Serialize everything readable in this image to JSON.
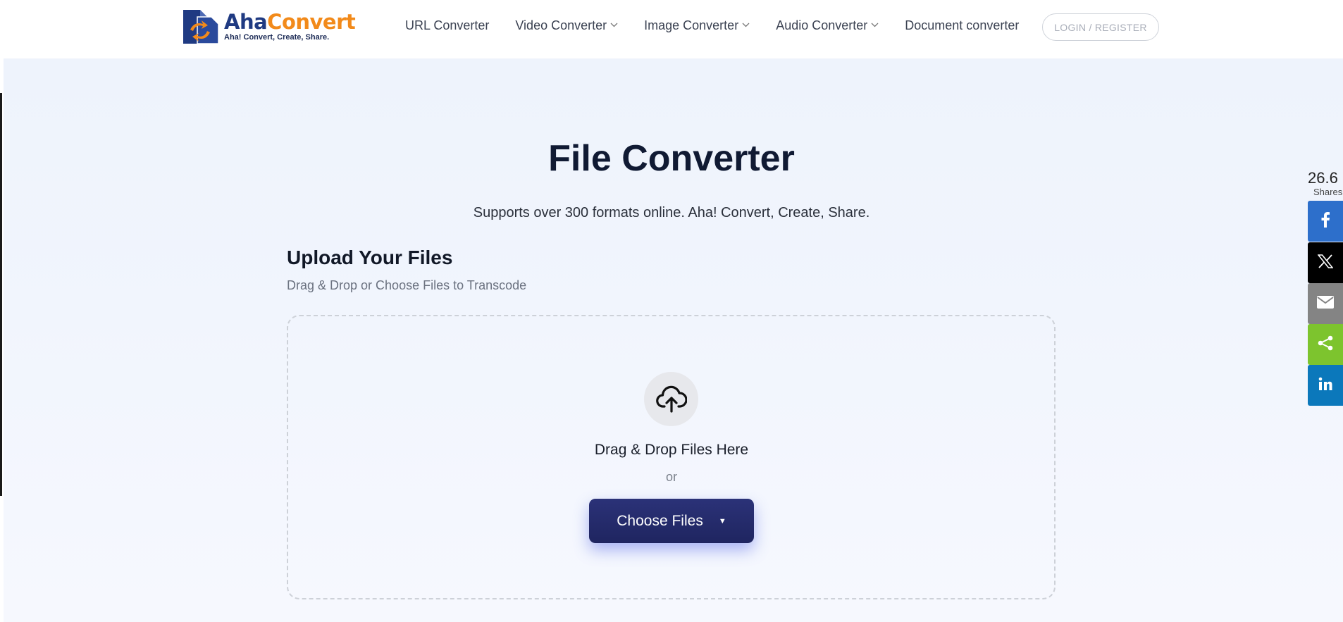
{
  "header": {
    "logo": {
      "brand_first": "Aha",
      "brand_second": "Convert",
      "tagline": "Aha! Convert, Create, Share."
    },
    "nav": [
      {
        "label": "URL Converter",
        "has_dropdown": false
      },
      {
        "label": "Video Converter",
        "has_dropdown": true
      },
      {
        "label": "Image Converter",
        "has_dropdown": true
      },
      {
        "label": "Audio Converter",
        "has_dropdown": true
      },
      {
        "label": "Document converter",
        "has_dropdown": false
      }
    ],
    "login_label": "LOGIN / REGISTER"
  },
  "hero": {
    "title": "File Converter",
    "subtitle": "Supports over 300 formats online. Aha! Convert, Create, Share."
  },
  "upload": {
    "title": "Upload Your Files",
    "subtitle": "Drag & Drop or Choose Files to Transcode",
    "drop_text": "Drag & Drop Files Here",
    "or_text": "or",
    "choose_label": "Choose Files",
    "icon": "cloud-upload-icon"
  },
  "share": {
    "count": "26.6",
    "count_label": "Shares",
    "buttons": [
      {
        "name": "facebook",
        "icon": "facebook-icon",
        "color": "#2d6fcb"
      },
      {
        "name": "x",
        "icon": "x-icon",
        "color": "#000000"
      },
      {
        "name": "email",
        "icon": "mail-icon",
        "color": "#848484"
      },
      {
        "name": "share",
        "icon": "share-icon",
        "color": "#7dc42e"
      },
      {
        "name": "linkedin",
        "icon": "linkedin-icon",
        "color": "#0b78bb"
      }
    ]
  },
  "colors": {
    "brand_blue": "#1f3a82",
    "brand_orange": "#f28a1a",
    "button_navy": "#232a6b",
    "hero_bg": "#eef3fc"
  }
}
